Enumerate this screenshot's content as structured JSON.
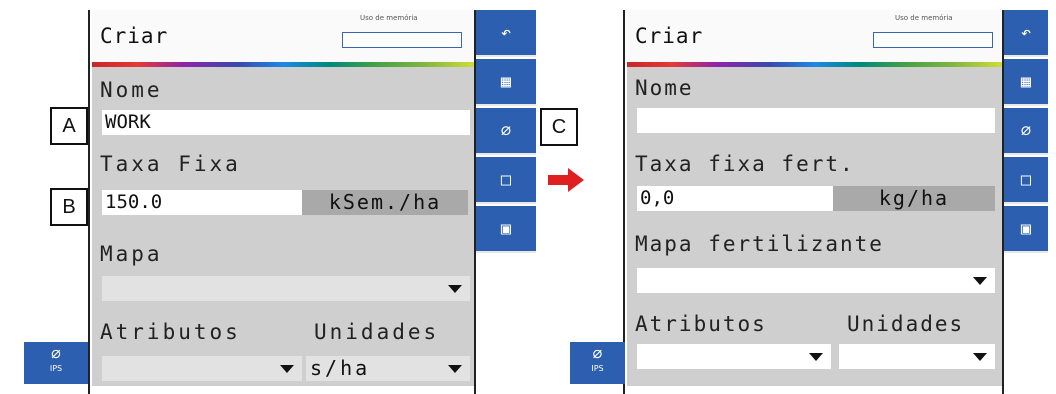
{
  "arrow_color": "#e02020",
  "callouts": {
    "a": "A",
    "b": "B",
    "c": "C"
  },
  "left": {
    "title": "Criar",
    "mem_label": "Uso de memória",
    "nome_label": "Nome",
    "nome_value": "WORK",
    "taxa_label": "Taxa Fixa",
    "taxa_value": "150.0",
    "taxa_unit": "kSem./ha",
    "mapa_label": "Mapa",
    "mapa_value": "",
    "atributos_label": "Atributos",
    "unidades_label": "Unidades",
    "atributos_value": "",
    "unidades_value": "s/ha",
    "ips_label": "IPS",
    "toolbar": [
      "back-icon",
      "map-icon",
      "leaf-icon",
      "square-icon",
      "save-icon"
    ]
  },
  "right": {
    "title": "Criar",
    "mem_label": "Uso de memória",
    "nome_label": "Nome",
    "nome_value": "",
    "taxa_label": "Taxa fixa fert.",
    "taxa_value": "0,0",
    "taxa_unit": "kg/ha",
    "mapa_label": "Mapa fertilizante",
    "mapa_value": "",
    "atributos_label": "Atributos",
    "unidades_label": "Unidades",
    "atributos_value": "",
    "unidades_value": "",
    "ips_label": "IPS",
    "toolbar": [
      "back-icon",
      "map-icon",
      "leaf-icon",
      "square-icon",
      "save-icon"
    ]
  }
}
